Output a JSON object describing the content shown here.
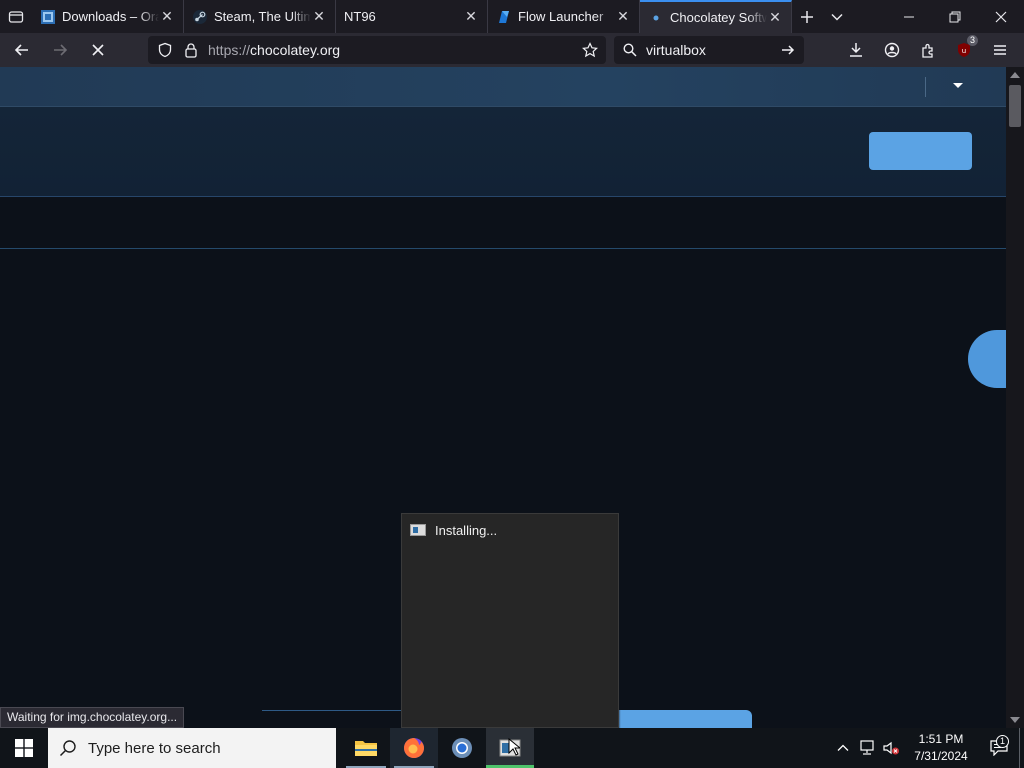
{
  "tabs": [
    {
      "title": "Downloads – Oracle VM VirtualBox",
      "favicon": "virtualbox-icon",
      "active": false
    },
    {
      "title": "Steam, The Ultimate Online Game Platform",
      "favicon": "steam-icon",
      "active": false
    },
    {
      "title": "NT96",
      "favicon": "",
      "active": false
    },
    {
      "title": "Flow Launcher",
      "favicon": "flow-launcher-icon",
      "active": false
    },
    {
      "title": "Chocolatey Software",
      "favicon": "loading-dot-icon",
      "active": true
    }
  ],
  "navbar": {
    "url_protocol": "https://",
    "url_host": "chocolatey.org",
    "search_value": "virtualbox",
    "extension_badge": "3"
  },
  "status_text": "Waiting for img.chocolatey.org...",
  "installer": {
    "title": "Installing..."
  },
  "taskbar": {
    "search_placeholder": "Type here to search",
    "time": "1:51 PM",
    "date": "7/31/2024",
    "notification_count": "1"
  },
  "colors": {
    "accent_blue": "#5ba3e4",
    "browser_chrome": "#2b2a33",
    "page_bg": "#0c1119",
    "site_topbar": "#213a55"
  }
}
